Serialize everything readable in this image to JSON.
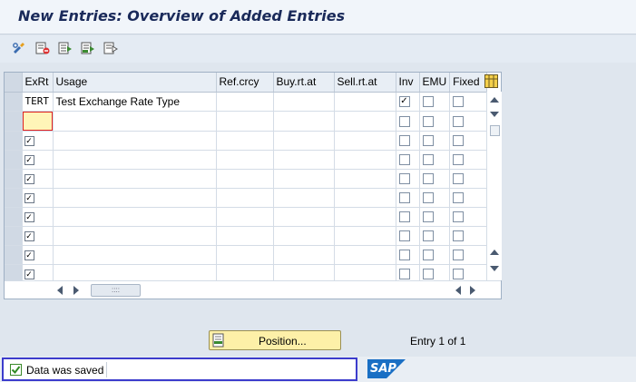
{
  "window": {
    "title": "New Entries: Overview of Added Entries"
  },
  "toolbar": {
    "buttons": [
      "display-change-icon",
      "delete-icon",
      "select-all-icon",
      "select-block-icon",
      "deselect-all-icon"
    ]
  },
  "table": {
    "columns": [
      "ExRt",
      "Usage",
      "Ref.crcy",
      "Buy.rt.at",
      "Sell.rt.at",
      "Inv",
      "EMU",
      "Fixed"
    ],
    "rows": [
      {
        "exrt": "TERT",
        "usage": "Test Exchange Rate Type",
        "inv": true,
        "emu": false,
        "fixed": false
      }
    ],
    "empty_rows": 9
  },
  "position_button": {
    "label": "Position..."
  },
  "entry_count": "Entry 1 of 1",
  "status": {
    "message": "Data was saved",
    "type": "success"
  },
  "brand": {
    "logo": "SAP",
    "color": "#1a6fc4"
  }
}
